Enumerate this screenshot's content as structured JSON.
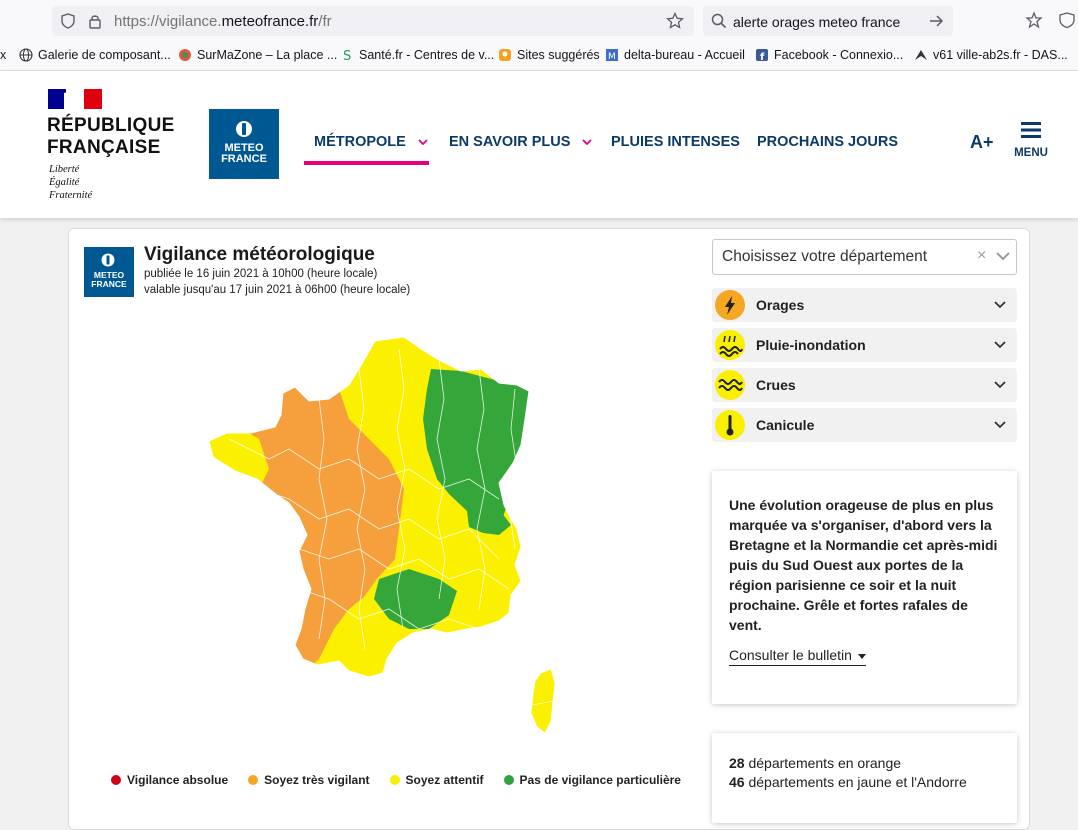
{
  "browser": {
    "url_prefix": "https://vigilance.",
    "url_domain": "meteofrance.fr",
    "url_suffix": "/fr",
    "search_text": "alerte orages meteo france"
  },
  "bookmarks": [
    {
      "label": "x",
      "icon": "close-fragment"
    },
    {
      "label": "Galerie de composant...",
      "icon": "globe-icon"
    },
    {
      "label": "SurMaZone – La place ...",
      "icon": "surmazone-icon"
    },
    {
      "label": "Santé.fr - Centres de v...",
      "icon": "sante-icon"
    },
    {
      "label": "Sites suggérés",
      "icon": "suggested-icon"
    },
    {
      "label": "delta-bureau - Accueil",
      "icon": "delta-icon"
    },
    {
      "label": "Facebook - Connexio...",
      "icon": "facebook-icon"
    },
    {
      "label": "v61 ville-ab2s.fr - DAS...",
      "icon": "ab2s-icon"
    }
  ],
  "header": {
    "rf_title_line1": "RÉPUBLIQUE",
    "rf_title_line2": "FRANÇAISE",
    "rf_motto_1": "Liberté",
    "rf_motto_2": "Égalité",
    "rf_motto_3": "Fraternité",
    "mf_logo_line1": "METEO",
    "mf_logo_line2": "FRANCE",
    "nav": [
      "MÉTROPOLE",
      "EN SAVOIR PLUS",
      "PLUIES INTENSES",
      "PROCHAINS JOURS"
    ],
    "font_size_label": "A+",
    "menu_label": "MENU"
  },
  "card": {
    "title": "Vigilance météorologique",
    "published": "publiée le 16 juin 2021 à 10h00 (heure locale)",
    "valid_until": "valable jusqu'au 17 juin 2021 à 06h00 (heure locale)",
    "logo_line1": "METEO",
    "logo_line2": "FRANCE"
  },
  "department_select": {
    "placeholder": "Choisissez votre département",
    "clear": "×"
  },
  "risks": [
    {
      "label": "Orages",
      "icon": "storm-icon"
    },
    {
      "label": "Pluie-inondation",
      "icon": "flood-icon"
    },
    {
      "label": "Crues",
      "icon": "waves-icon"
    },
    {
      "label": "Canicule",
      "icon": "thermometer-icon"
    }
  ],
  "bulletin": {
    "text": "Une évolution orageuse de plus en plus marquée va s'organiser, d'abord vers la Bretagne et la Normandie cet après-midi puis du Sud Ouest aux portes de la région parisienne ce soir et la nuit prochaine. Grêle et fortes rafales de vent.",
    "link": "Consulter le bulletin"
  },
  "stats": {
    "orange_count": "28",
    "orange_text": "départements en orange",
    "yellow_count": "46",
    "yellow_text": "départements en jaune et l'Andorre"
  },
  "legend": [
    {
      "label": "Vigilance absolue",
      "color": "#d0021b"
    },
    {
      "label": "Soyez très vigilant",
      "color": "#f5a623"
    },
    {
      "label": "Soyez attentif",
      "color": "#f8f000"
    },
    {
      "label": "Pas de vigilance particulière",
      "color": "#2fa13f"
    }
  ],
  "colors": {
    "orange": "#f5a03c",
    "yellow": "#faf000",
    "green": "#34a63a",
    "brand_blue": "#005892",
    "nav_blue": "#0b3a66",
    "accent_pink": "#e6007e"
  }
}
